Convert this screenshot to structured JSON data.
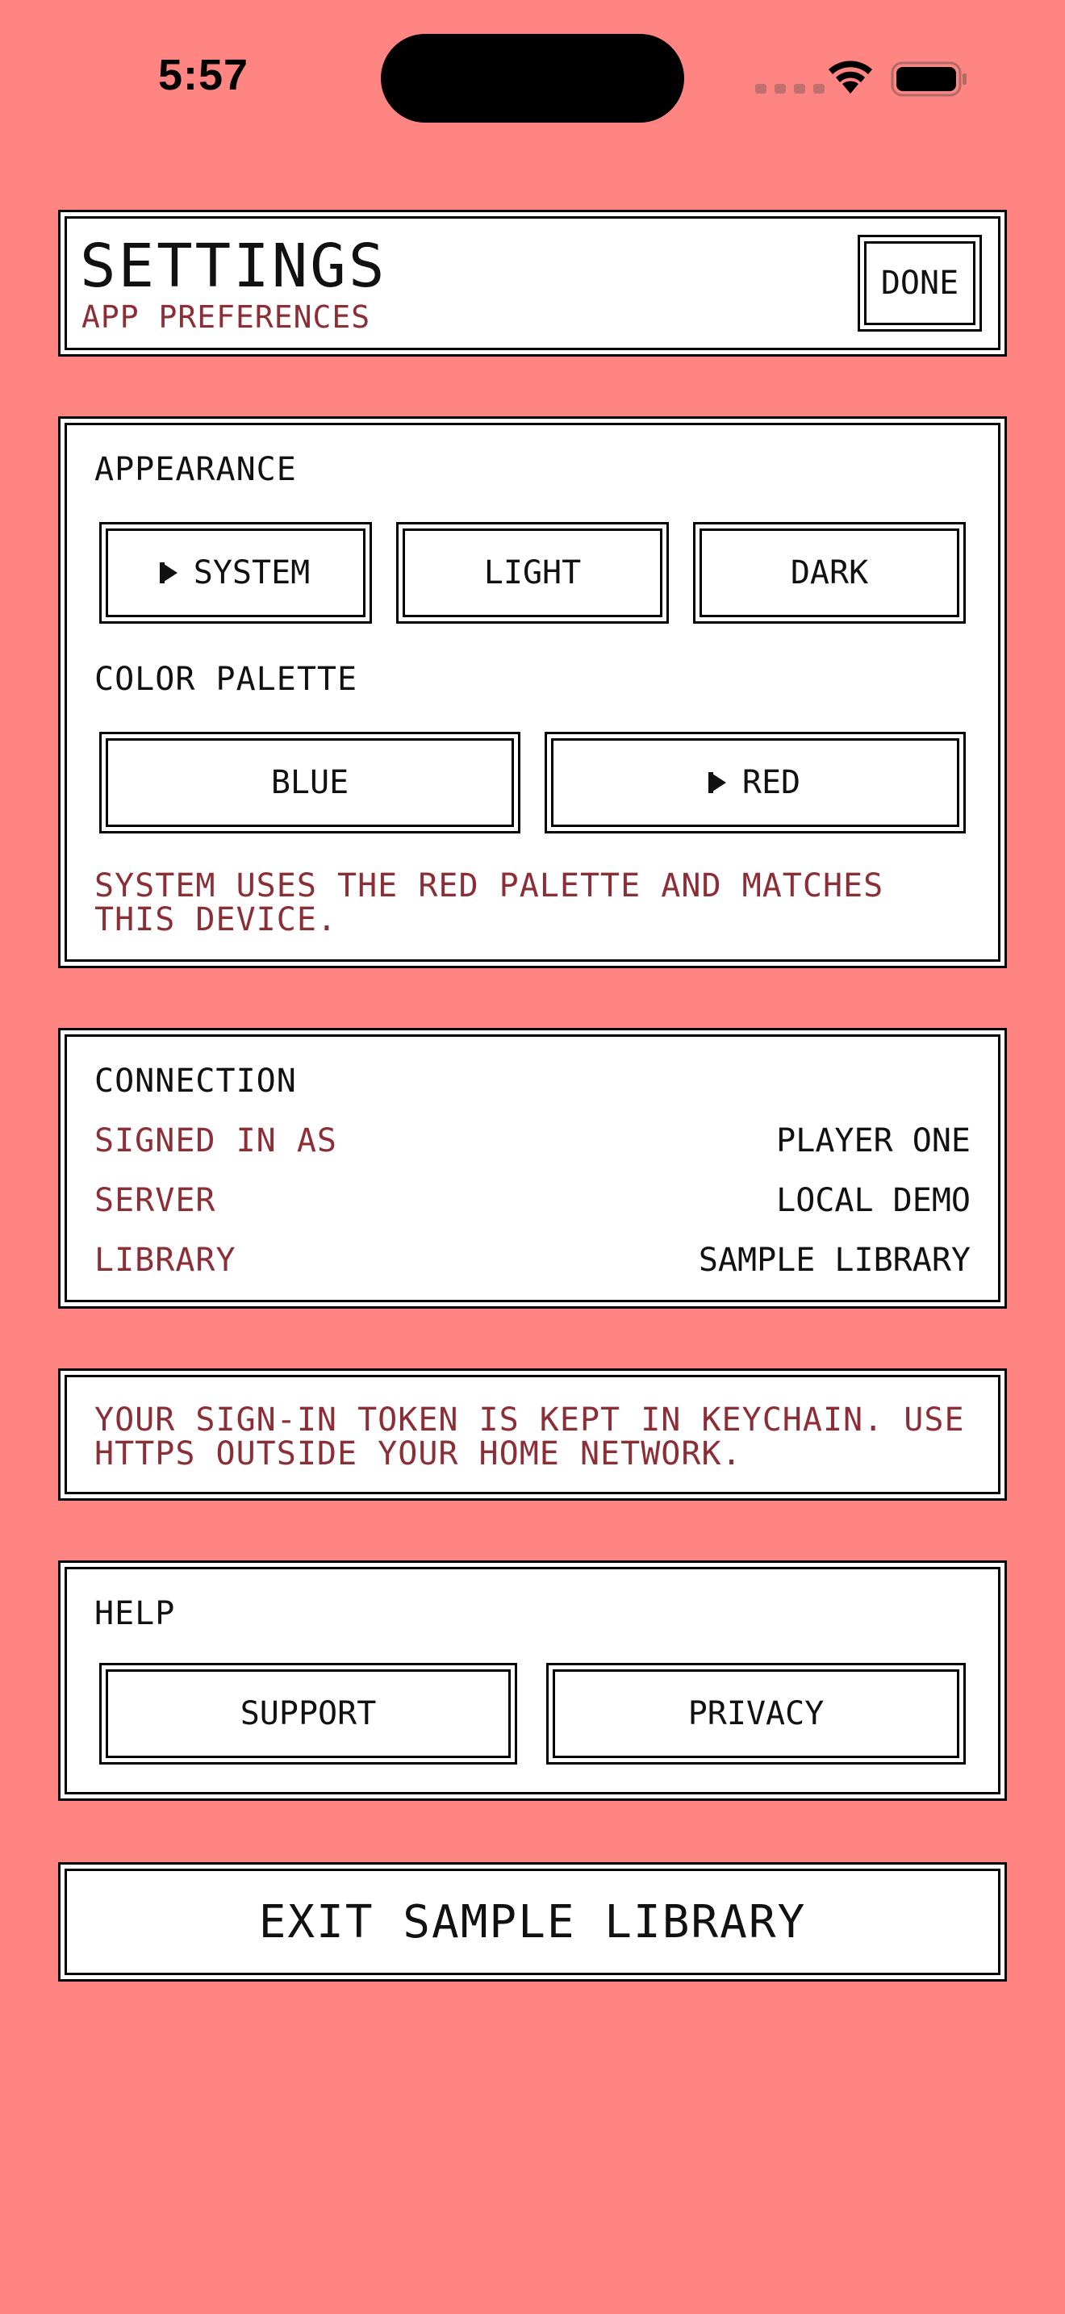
{
  "status_bar": {
    "time": "5:57"
  },
  "header": {
    "title": "SETTINGS",
    "subtitle": "APP PREFERENCES",
    "done_label": "DONE"
  },
  "appearance": {
    "heading": "APPEARANCE",
    "options": [
      {
        "label": "SYSTEM",
        "selected": true
      },
      {
        "label": "LIGHT",
        "selected": false
      },
      {
        "label": "DARK",
        "selected": false
      }
    ],
    "palette_heading": "COLOR PALETTE",
    "palettes": [
      {
        "label": "BLUE",
        "selected": false
      },
      {
        "label": "RED",
        "selected": true
      }
    ],
    "note_line1": "SYSTEM USES THE RED PALETTE AND MATCHES",
    "note_line2": "THIS DEVICE."
  },
  "connection": {
    "heading": "CONNECTION",
    "rows": [
      {
        "key": "SIGNED IN AS",
        "value": "PLAYER ONE"
      },
      {
        "key": "SERVER",
        "value": "LOCAL DEMO"
      },
      {
        "key": "LIBRARY",
        "value": "SAMPLE LIBRARY"
      }
    ]
  },
  "security_note": {
    "line1": "YOUR SIGN-IN TOKEN IS KEPT IN KEYCHAIN. USE",
    "line2": "HTTPS OUTSIDE YOUR HOME NETWORK."
  },
  "help": {
    "heading": "HELP",
    "support_label": "SUPPORT",
    "privacy_label": "PRIVACY"
  },
  "exit_label": "EXIT SAMPLE LIBRARY",
  "colors": {
    "background": "#FF8582",
    "muted_text": "#8B2E35",
    "panel": "#FFFFFF",
    "border": "#000000"
  }
}
